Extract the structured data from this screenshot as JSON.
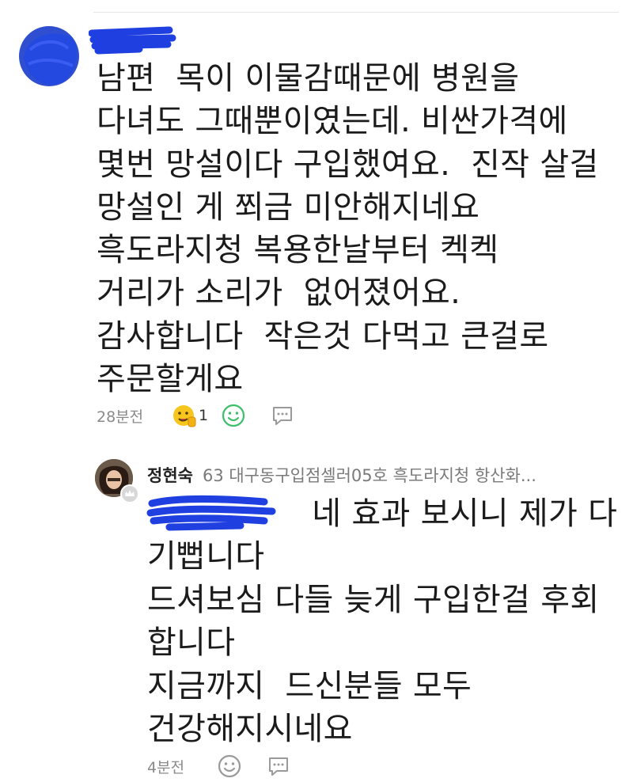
{
  "comment": {
    "text": "남편  목이 이물감때문에 병원을\n다녀도 그때뿐이였는데. 비싼가격에\n몇번 망설이다 구입했여요.  진작 살걸\n망설인 게 쬐금 미안해지네요\n흑도라지청 복용한날부터 켁켁\n거리가 소리가  없어졌어요.\n감사합니다  작은것 다먹고 큰걸로\n주문할게요",
    "time": "28분전",
    "like_count": "1"
  },
  "reply": {
    "author": "정현숙",
    "subtitle": "63 대구동구입점셀러05호 흑도라지청 항산화...",
    "text": "                네 효과 보시니 제가 다\n기뻡니다\n드셔보심 다들 늦게 구입한걸 후회\n합니다\n지금까지  드신분들 모두\n건강해지시네요",
    "time": "4분전"
  },
  "colors": {
    "redaction": "#1f3fe0",
    "reaction_green": "#3cbf6a",
    "icon_gray": "#9a9a9a"
  },
  "icons": [
    "like-emoji-icon",
    "smiley-icon",
    "comment-bubble-icon",
    "crown-icon"
  ]
}
